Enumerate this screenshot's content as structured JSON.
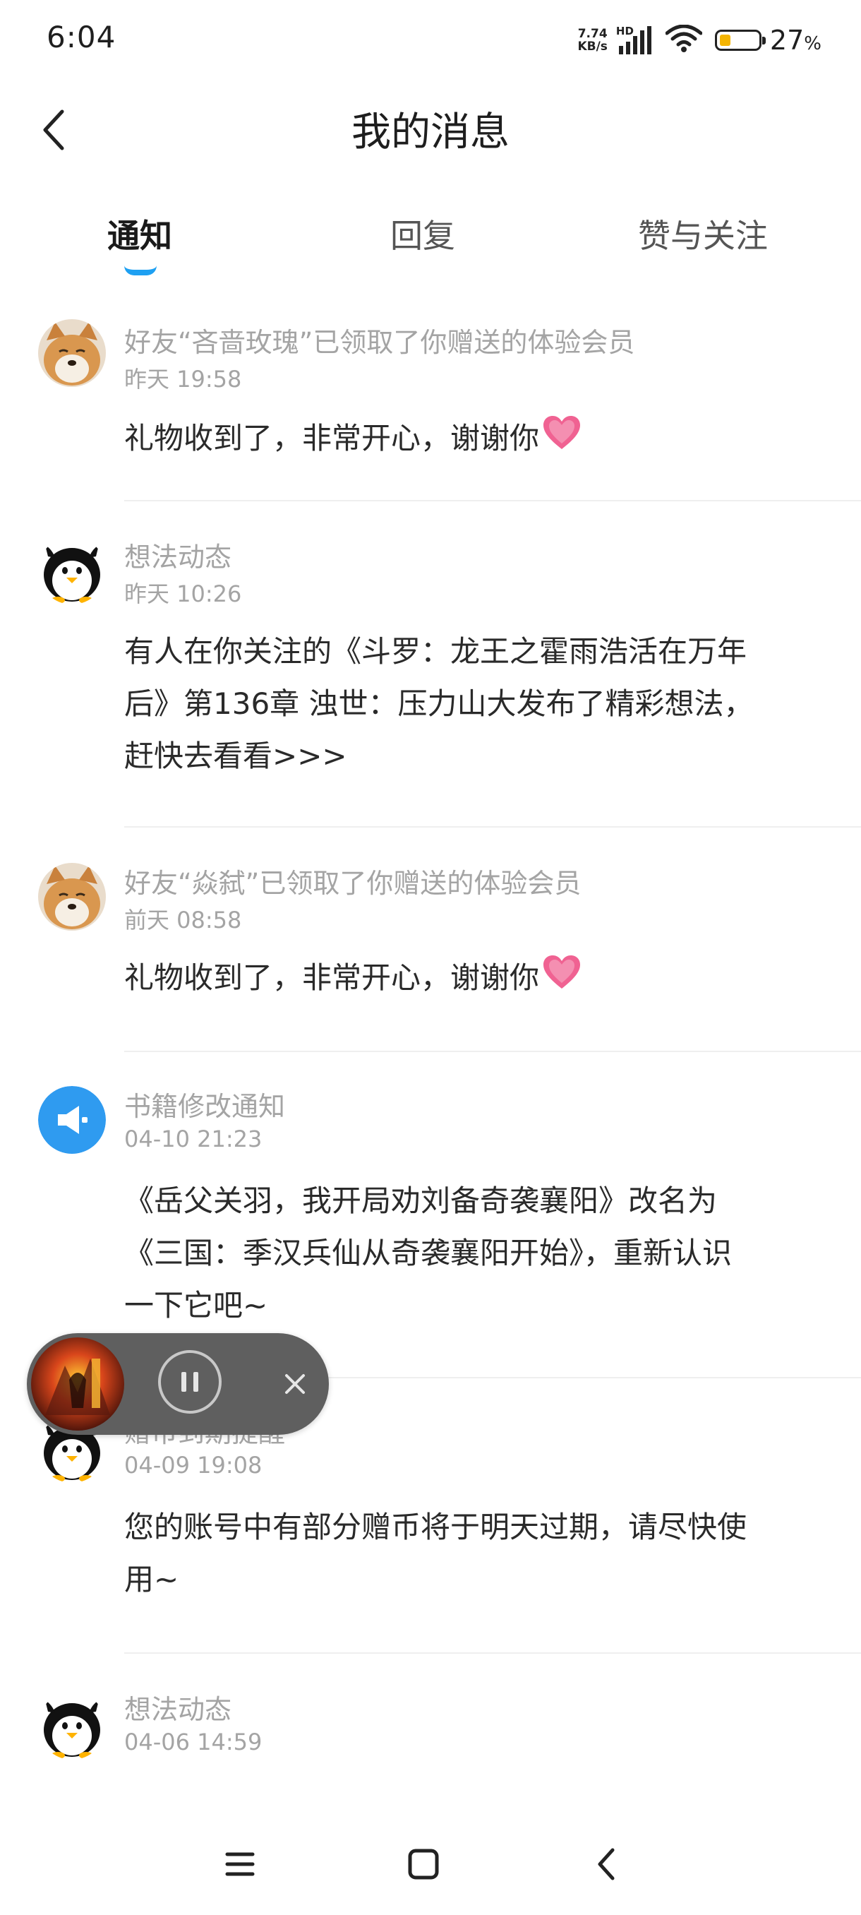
{
  "status_bar": {
    "time": "6:04",
    "net_speed_value": "7.74",
    "net_speed_unit": "KB/s",
    "hd_label": "HD",
    "battery_level": 27,
    "battery_text": "27",
    "battery_unit": "%"
  },
  "header": {
    "title": "我的消息"
  },
  "tabs": [
    {
      "label": "通知",
      "active": true
    },
    {
      "label": "回复",
      "active": false
    },
    {
      "label": "赞与关注",
      "active": false
    }
  ],
  "messages": [
    {
      "avatar": "shiba-dog-avatar",
      "title": "好友“吝啬玫瑰”已领取了你赠送的体验会员",
      "time": "昨天 19:58",
      "body": "礼物收到了，非常开心，谢谢你",
      "has_heart": true
    },
    {
      "avatar": "penguin-avatar",
      "title": "想法动态",
      "time": "昨天 10:26",
      "body_lines": [
        "有人在你关注的《斗罗：龙王之霍雨浩活在万年",
        "后》第136章 浊世：压力山大发布了精彩想法，",
        "赶快去看看>>>"
      ]
    },
    {
      "avatar": "shiba-dog-avatar",
      "title": "好友“焱弑”已领取了你赠送的体验会员",
      "time": "前天 08:58",
      "body": "礼物收到了，非常开心，谢谢你",
      "has_heart": true
    },
    {
      "avatar": "speaker-avatar",
      "title": "书籍修改通知",
      "time": "04-10 21:23",
      "body_lines": [
        "《岳父关羽，我开局劝刘备奇袭襄阳》改名为",
        "《三国：季汉兵仙从奇袭襄阳开始》，重新认识",
        "一下它吧~"
      ]
    },
    {
      "avatar": "penguin-avatar",
      "title": "赠币到期提醒",
      "time": "04-09 19:08",
      "body_lines": [
        "您的账号中有部分赠币将于明天过期，请尽快使",
        "用~"
      ]
    },
    {
      "avatar": "penguin-avatar",
      "title": "想法动态",
      "time": "04-06 14:59"
    }
  ],
  "colors": {
    "accent": "#1ea0f2",
    "secondary_text": "#a4a4a4",
    "primary_text": "#2a2a2a",
    "player_bg": "#5f5f5f"
  }
}
